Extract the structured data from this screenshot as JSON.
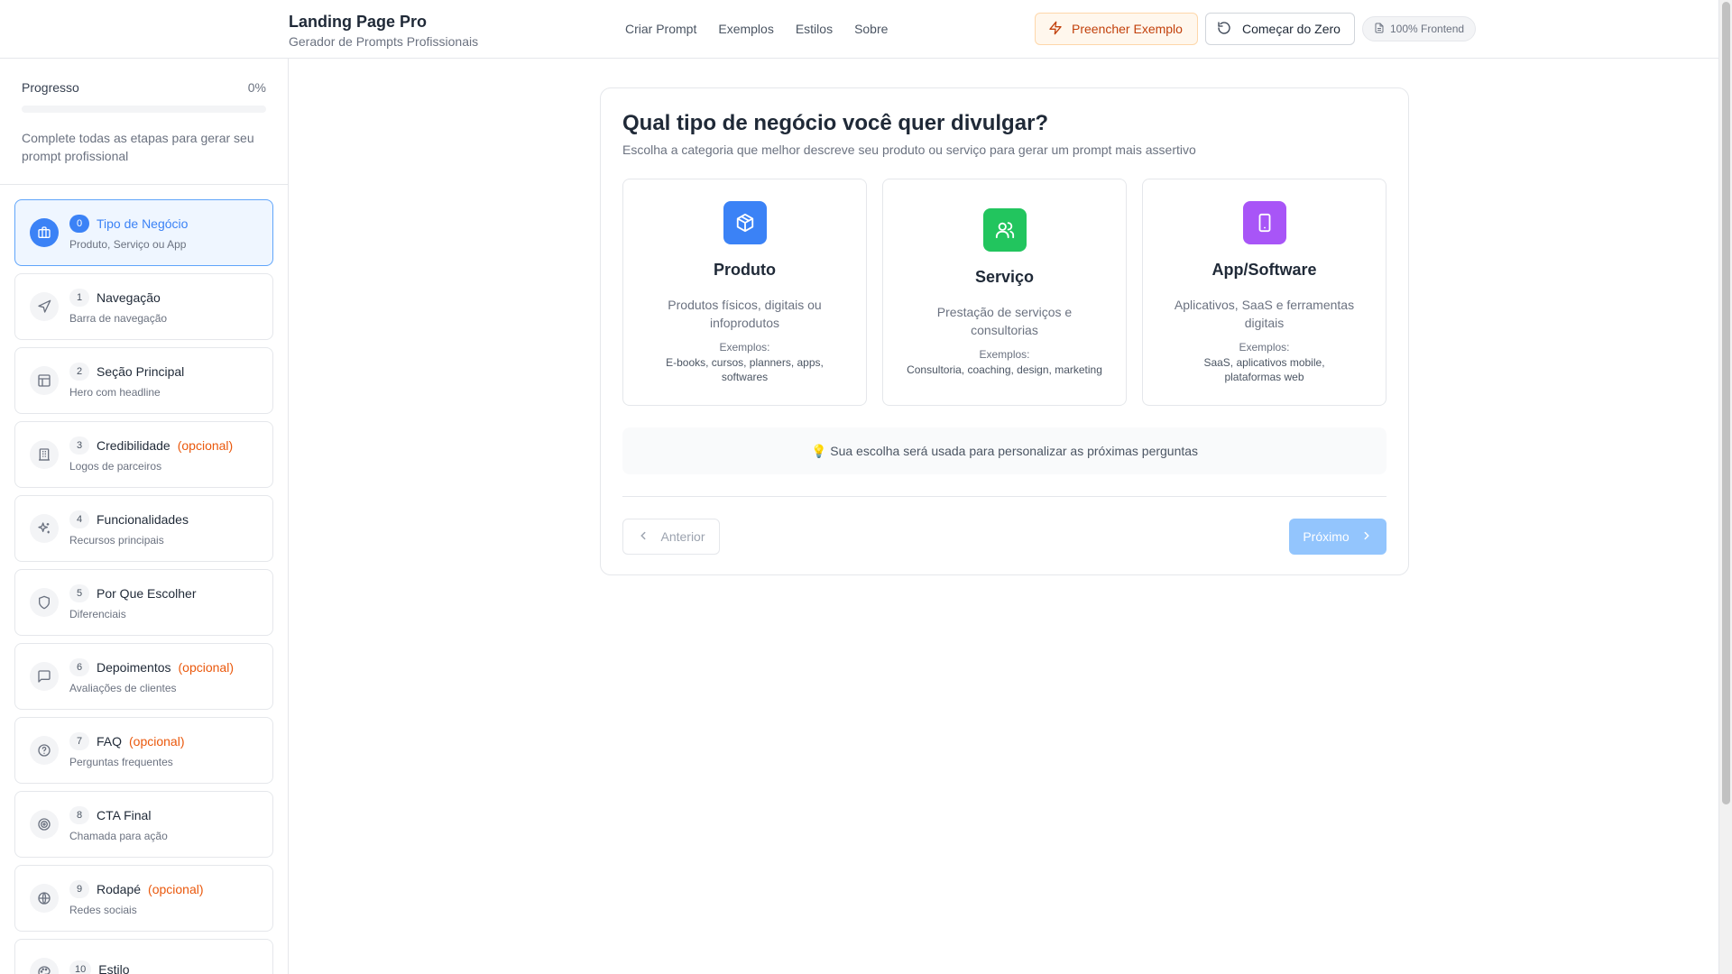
{
  "header": {
    "title": "Landing Page Pro",
    "subtitle": "Gerador de Prompts Profissionais",
    "nav": [
      "Criar Prompt",
      "Exemplos",
      "Estilos",
      "Sobre"
    ],
    "fill_example": "Preencher Exemplo",
    "start_over": "Começar do Zero",
    "badge": "100% Frontend"
  },
  "sidebar": {
    "progress_label": "Progresso",
    "progress_pct": "0%",
    "progress_value": 0,
    "progress_note": "Complete todas as etapas para gerar seu prompt profissional",
    "steps": [
      {
        "num": "0",
        "title": "Tipo de Negócio",
        "optional": "",
        "sub": "Produto, Serviço ou App",
        "icon": "briefcase-icon"
      },
      {
        "num": "1",
        "title": "Navegação",
        "optional": "",
        "sub": "Barra de navegação",
        "icon": "navigation-icon"
      },
      {
        "num": "2",
        "title": "Seção Principal",
        "optional": "",
        "sub": "Hero com headline",
        "icon": "layout-icon"
      },
      {
        "num": "3",
        "title": "Credibilidade",
        "optional": "(opcional)",
        "sub": "Logos de parceiros",
        "icon": "building-icon"
      },
      {
        "num": "4",
        "title": "Funcionalidades",
        "optional": "",
        "sub": "Recursos principais",
        "icon": "sparkles-icon"
      },
      {
        "num": "5",
        "title": "Por Que Escolher",
        "optional": "",
        "sub": "Diferenciais",
        "icon": "shield-icon"
      },
      {
        "num": "6",
        "title": "Depoimentos",
        "optional": "(opcional)",
        "sub": "Avaliações de clientes",
        "icon": "message-icon"
      },
      {
        "num": "7",
        "title": "FAQ",
        "optional": "(opcional)",
        "sub": "Perguntas frequentes",
        "icon": "help-circle-icon"
      },
      {
        "num": "8",
        "title": "CTA Final",
        "optional": "",
        "sub": "Chamada para ação",
        "icon": "target-icon"
      },
      {
        "num": "9",
        "title": "Rodapé",
        "optional": "(opcional)",
        "sub": "Redes sociais",
        "icon": "globe-icon"
      },
      {
        "num": "10",
        "title": "Estilo",
        "optional": "",
        "sub": "",
        "icon": "palette-icon"
      }
    ]
  },
  "main": {
    "title": "Qual tipo de negócio você quer divulgar?",
    "subtitle": "Escolha a categoria que melhor descreve seu produto ou serviço para gerar um prompt mais assertivo",
    "options": [
      {
        "title": "Produto",
        "desc": "Produtos físicos, digitais ou infoprodutos",
        "examples_label": "Exemplos:",
        "examples": "E-books, cursos, planners, apps, softwares",
        "color": "#3b82f6",
        "icon": "package-icon"
      },
      {
        "title": "Serviço",
        "desc": "Prestação de serviços e consultorias",
        "examples_label": "Exemplos:",
        "examples": "Consultoria, coaching, design, marketing",
        "color": "#22c55e",
        "icon": "users-icon"
      },
      {
        "title": "App/Software",
        "desc": "Aplicativos, SaaS e ferramentas digitais",
        "examples_label": "Exemplos:",
        "examples": "SaaS, aplicativos mobile, plataformas web",
        "color": "#a855f7",
        "icon": "smartphone-icon"
      }
    ],
    "tip": "💡 Sua escolha será usada para personalizar as próximas perguntas",
    "prev": "Anterior",
    "next": "Próximo"
  },
  "colors": {
    "accent": "#3b82f6",
    "optional": "#ea580c"
  }
}
